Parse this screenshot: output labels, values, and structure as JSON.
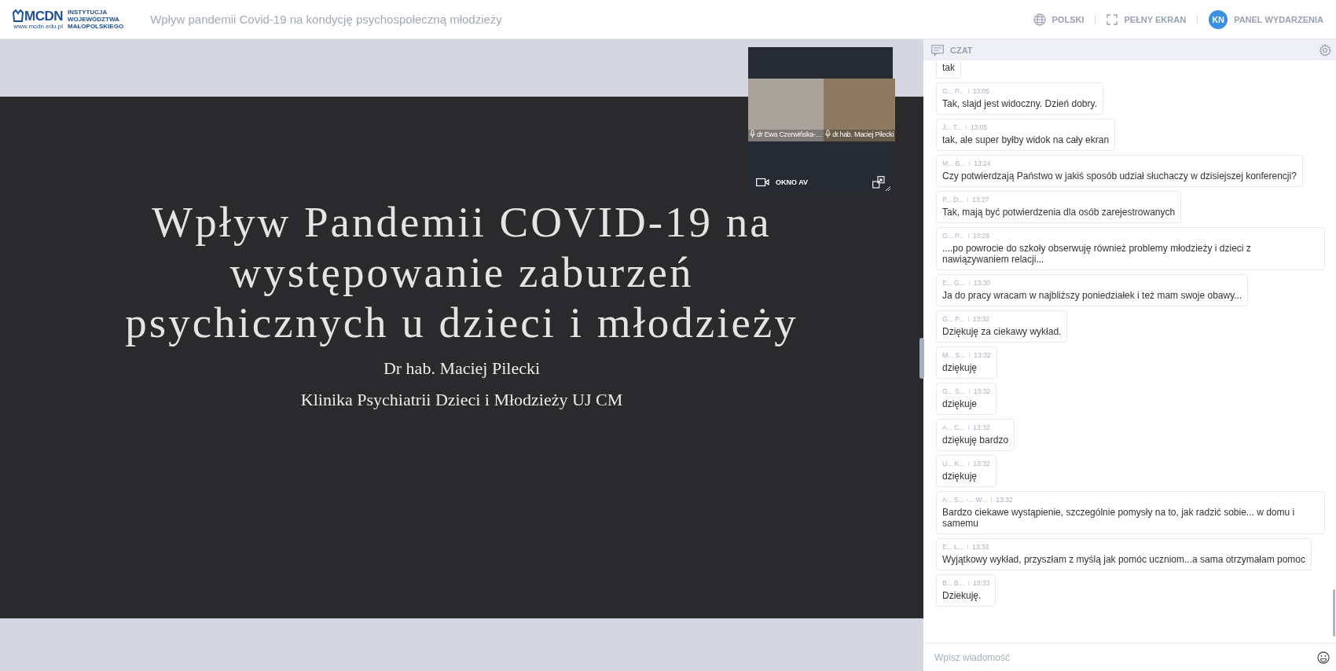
{
  "header": {
    "logo": {
      "mark": "MCDN",
      "lines": [
        "INSTYTUCJA",
        "WOJEWÓDZTWA",
        "MAŁOPOLSKIEGO"
      ],
      "url": "www.mcdn.edu.pl"
    },
    "title": "Wpływ pandemii Covid-19 na kondycję psychospołeczną młodzieży",
    "actions": [
      {
        "kind": "language",
        "label": "POLSKI"
      },
      {
        "kind": "fullscreen",
        "label": "PEŁNY EKRAN"
      },
      {
        "kind": "panel",
        "label": "PANEL WYDARZENIA",
        "avatar": "KN"
      }
    ]
  },
  "slide": {
    "title_lines": [
      "Wpływ Pandemii COVID-19 na",
      "występowanie zaburzeń",
      "psychicznych u dzieci i młodzieży"
    ],
    "subtitle_lines": [
      "Dr hab. Maciej Pilecki",
      "Klinika Psychiatrii Dzieci i Młodzieży UJ CM"
    ]
  },
  "av_window": {
    "participants": [
      {
        "name": "dr Ewa Czerwińska-…"
      },
      {
        "name": "dr.hab. Maciej Pilecki"
      }
    ],
    "label": "OKNO AV"
  },
  "chat": {
    "title": "CZAT",
    "messages": [
      {
        "text": "tak"
      },
      {
        "author": "G... P...",
        "time": "13:05",
        "text": "Tak, slajd jest widoczny. Dzień dobry."
      },
      {
        "author": "J... T...",
        "time": "13:05",
        "text": "tak, ale super byłby widok na cały ekran"
      },
      {
        "author": "M... B...",
        "time": "13:24",
        "text": "Czy potwierdzają Państwo w jakiś sposób udział słuchaczy w dzisiejszej konferencji?"
      },
      {
        "author": "P... D...",
        "time": "13:27",
        "text": "Tak, mają być potwierdzenia dla osób zarejestrowanych"
      },
      {
        "author": "G... P...",
        "time": "13:29",
        "text": "....po powrocie do szkoły obserwuję również problemy młodzieży i dzieci z nawiązywaniem relacji..."
      },
      {
        "author": "E... G...",
        "time": "13:30",
        "text": "Ja do pracy wracam w najbliższy poniedziałek i też mam swoje obawy..."
      },
      {
        "author": "G... P...",
        "time": "13:32",
        "text": "Dziękuję za ciekawy wykład."
      },
      {
        "author": "M... S...",
        "time": "13:32",
        "text": "dziękuję"
      },
      {
        "author": "G... S...",
        "time": "13:32",
        "text": "dziękuje"
      },
      {
        "author": "A... C...",
        "time": "13:32",
        "text": "dziękuję bardzo"
      },
      {
        "author": "U... K...",
        "time": "13:32",
        "text": "dziękuję"
      },
      {
        "author": "A... S... -... W...",
        "time": "13:32",
        "text": "Bardzo ciekawe wystąpienie, szczególnie pomysły na to, jak radzić sobie... w domu i samemu"
      },
      {
        "author": "E... Ł...",
        "time": "13:33",
        "text": "Wyjątkowy wykład, przyszłam z myślą  jak pomóc uczniom...a sama otrzymałam pomoc"
      },
      {
        "author": "B... B...",
        "time": "13:33",
        "text": "Dziekuję."
      }
    ],
    "input": {
      "placeholder": "Wpisz wiadomość"
    }
  }
}
